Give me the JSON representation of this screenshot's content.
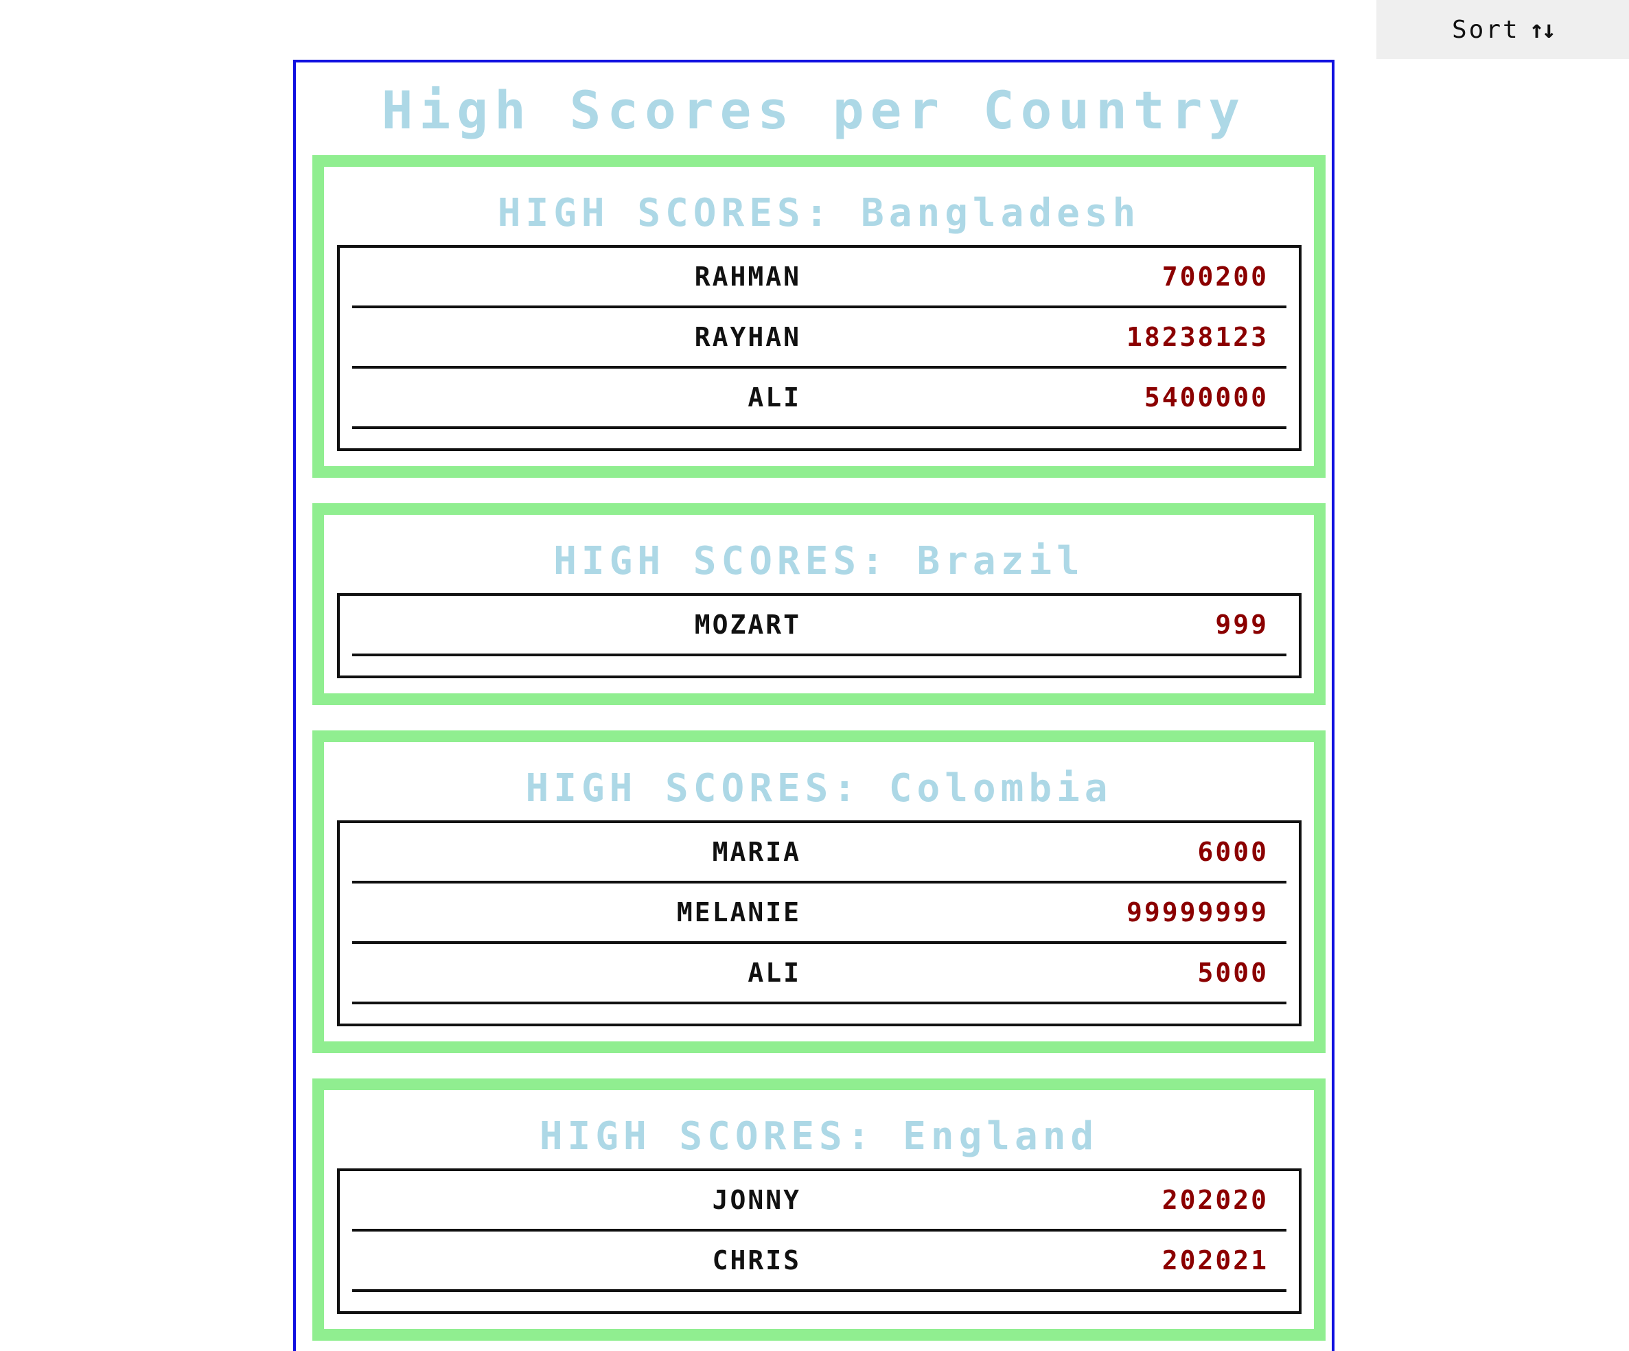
{
  "toolbar": {
    "sort_label": "Sort",
    "sort_icon": "↑↓"
  },
  "page": {
    "title": "High Scores per Country"
  },
  "countries": [
    {
      "title": "HIGH SCORES: Bangladesh",
      "rows": [
        {
          "name": "RAHMAN",
          "score": "700200"
        },
        {
          "name": "RAYHAN",
          "score": "18238123"
        },
        {
          "name": "ALI",
          "score": "5400000"
        }
      ]
    },
    {
      "title": "HIGH SCORES: Brazil",
      "rows": [
        {
          "name": "MOZART",
          "score": "999"
        }
      ]
    },
    {
      "title": "HIGH SCORES: Colombia",
      "rows": [
        {
          "name": "MARIA",
          "score": "6000"
        },
        {
          "name": "MELANIE",
          "score": "99999999"
        },
        {
          "name": "ALI",
          "score": "5000"
        }
      ]
    },
    {
      "title": "HIGH SCORES: England",
      "rows": [
        {
          "name": "JONNY",
          "score": "202020"
        },
        {
          "name": "CHRIS",
          "score": "202021"
        }
      ]
    }
  ],
  "colors": {
    "title": "#add8e6",
    "card_border": "#90ee90",
    "frame_border": "#1010e0",
    "score": "#8b0000",
    "name": "#111111"
  }
}
